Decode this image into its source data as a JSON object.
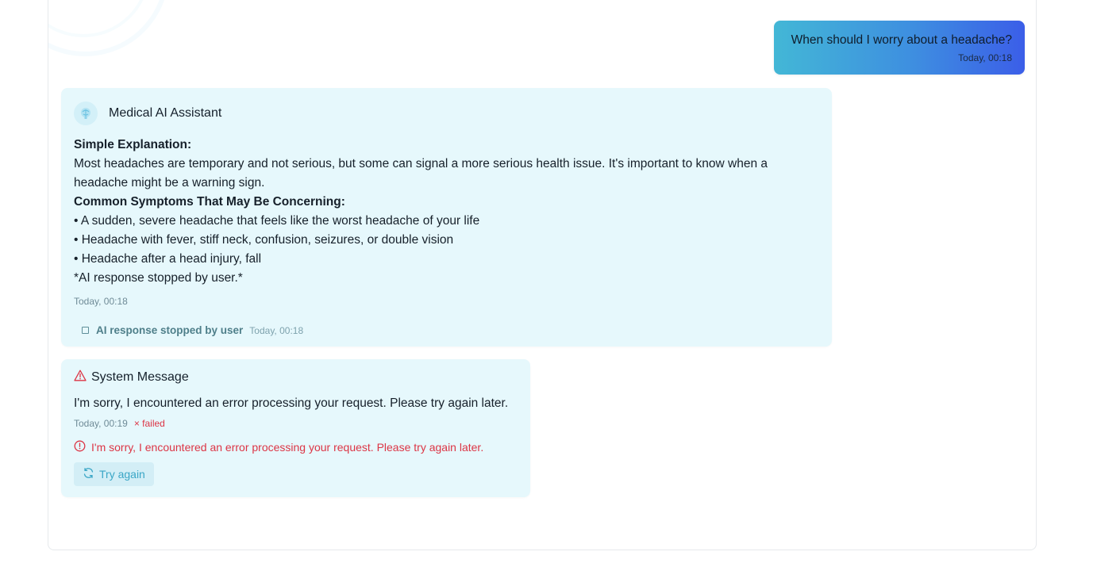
{
  "user_message": {
    "text": "When should I worry about a headache?",
    "time": "Today, 00:18"
  },
  "assistant_message": {
    "sender": "Medical AI Assistant",
    "avatar_icon": "brain-icon",
    "heading_1": "Simple Explanation:",
    "explanation": "Most headaches are temporary and not serious, but some can signal a more serious health issue. It's important to know when a headache might be a warning sign.",
    "heading_2": "Common Symptoms That May Be Concerning:",
    "bullets": [
      "• A sudden, severe headache that feels like the worst headache of your life",
      "• Headache with fever, stiff neck, confusion, seizures, or double vision",
      "• Headache after a head injury, fall"
    ],
    "stopped_note": "*AI response stopped by user.*",
    "time": "Today, 00:18",
    "stopped_status": {
      "label": "AI response stopped by user",
      "time": "Today, 00:18"
    }
  },
  "system_message": {
    "title": "System Message",
    "text": "I'm sorry, I encountered an error processing your request. Please try again later.",
    "time": "Today, 00:19",
    "status": "× failed",
    "error_text": "I'm sorry, I encountered an error processing your request. Please try again later.",
    "retry_label": "Try again"
  },
  "colors": {
    "bubble_bg": "#e6f8fc",
    "user_gradient_start": "#43b7d6",
    "user_gradient_end": "#3b5ee8",
    "error": "#dc3545",
    "retry_text": "#3aa6c6"
  }
}
